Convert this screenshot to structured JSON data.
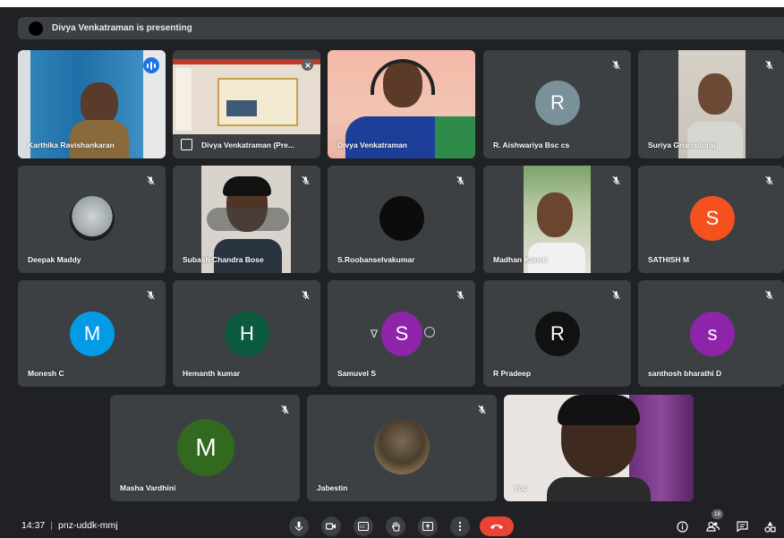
{
  "banner": {
    "presenting_text": "Divya Venkatraman is presenting"
  },
  "tiles": {
    "karthika": "Karthika Ravishankaran",
    "divya_pres": "Divya Venkatraman (Pre...",
    "divya": "Divya Venkatraman",
    "aishwariya": "R. Aishwariya Bsc cs",
    "suriya": "Suriya Gnanadurai",
    "deepak": "Deepak Maddy",
    "subash": "Subash Chandra Bose",
    "roobans": "S.Roobanselvakumar",
    "madhan": "Madhan Kumar",
    "sathish": "SATHISH M",
    "monesh": "Monesh C",
    "hemanth": "Hemanth kumar",
    "samuvel": "Samuvel S",
    "pradeep": "R Pradeep",
    "santhosh": "santhosh bharathi D",
    "masha": "Masha Vardhini",
    "jabestin": "Jabestin",
    "you": "You"
  },
  "avatars": {
    "aishwariya": {
      "letter": "R",
      "color": "#7a909a"
    },
    "sathish": {
      "letter": "S",
      "color": "#f4511e"
    },
    "monesh": {
      "letter": "M",
      "color": "#039be5"
    },
    "hemanth": {
      "letter": "H",
      "color": "#0b5c3e"
    },
    "samuvel": {
      "letter": "S",
      "color": "#8e24aa"
    },
    "pradeep": {
      "letter": "R",
      "color": "#111111"
    },
    "santhosh": {
      "letter": "s",
      "color": "#8e24aa"
    },
    "masha": {
      "letter": "M",
      "color": "#33691e"
    }
  },
  "bottom": {
    "time": "14:37",
    "separator": "|",
    "meeting_code": "pnz-uddk-mmj",
    "participant_count": "18"
  },
  "icons": {
    "mic": "microphone-icon",
    "camera": "camera-icon",
    "captions": "captions-icon",
    "hand": "raise-hand-icon",
    "present": "present-icon",
    "more": "more-options-icon",
    "end": "end-call-icon",
    "info": "info-icon",
    "people": "people-icon",
    "chat": "chat-icon",
    "activities": "activities-icon"
  }
}
